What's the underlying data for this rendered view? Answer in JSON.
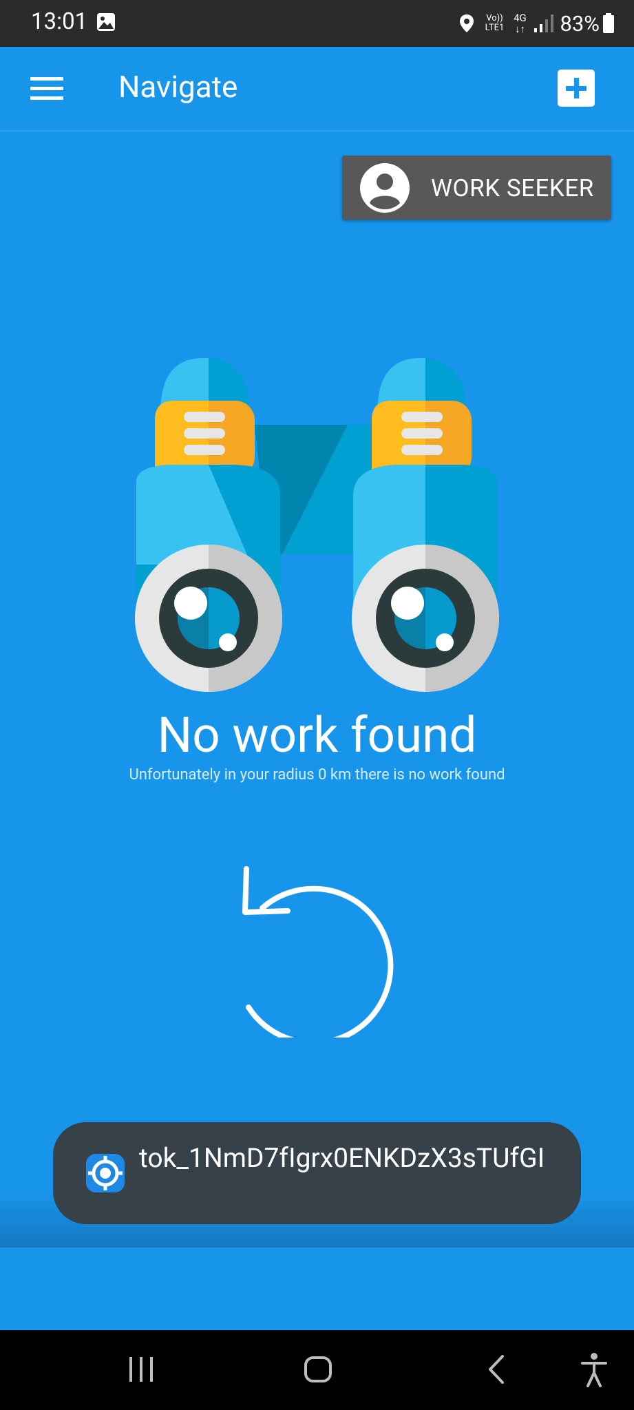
{
  "status_bar": {
    "time": "13:01",
    "network_volte": "Vo)) LTE1",
    "network_type": "4G",
    "battery": "83%",
    "icons": [
      "gallery-icon",
      "location-icon",
      "signal-icon",
      "battery-icon"
    ]
  },
  "app_bar": {
    "title": "Navigate",
    "menu_icon": "hamburger-menu-icon",
    "add_icon": "add-box-icon"
  },
  "role_button": {
    "label": "WORK SEEKER",
    "icon": "account-circle-icon"
  },
  "empty_state": {
    "illustration": "binoculars",
    "title": "No work found",
    "subtitle": "Unfortunately in your radius 0 km there is no work found",
    "refresh_icon": "refresh-icon"
  },
  "toast": {
    "text": "tok_1NmD7fIgrx0ENKDzX3sTUfGI",
    "icon": "app-target-icon"
  },
  "nav_bar": {
    "buttons": [
      "recents-icon",
      "home-icon",
      "back-icon",
      "accessibility-icon"
    ]
  },
  "colors": {
    "primary": "#1795EB",
    "status_bar": "#2B2B2B",
    "role_button_bg": "#585858",
    "toast_bg": "#37414A"
  }
}
